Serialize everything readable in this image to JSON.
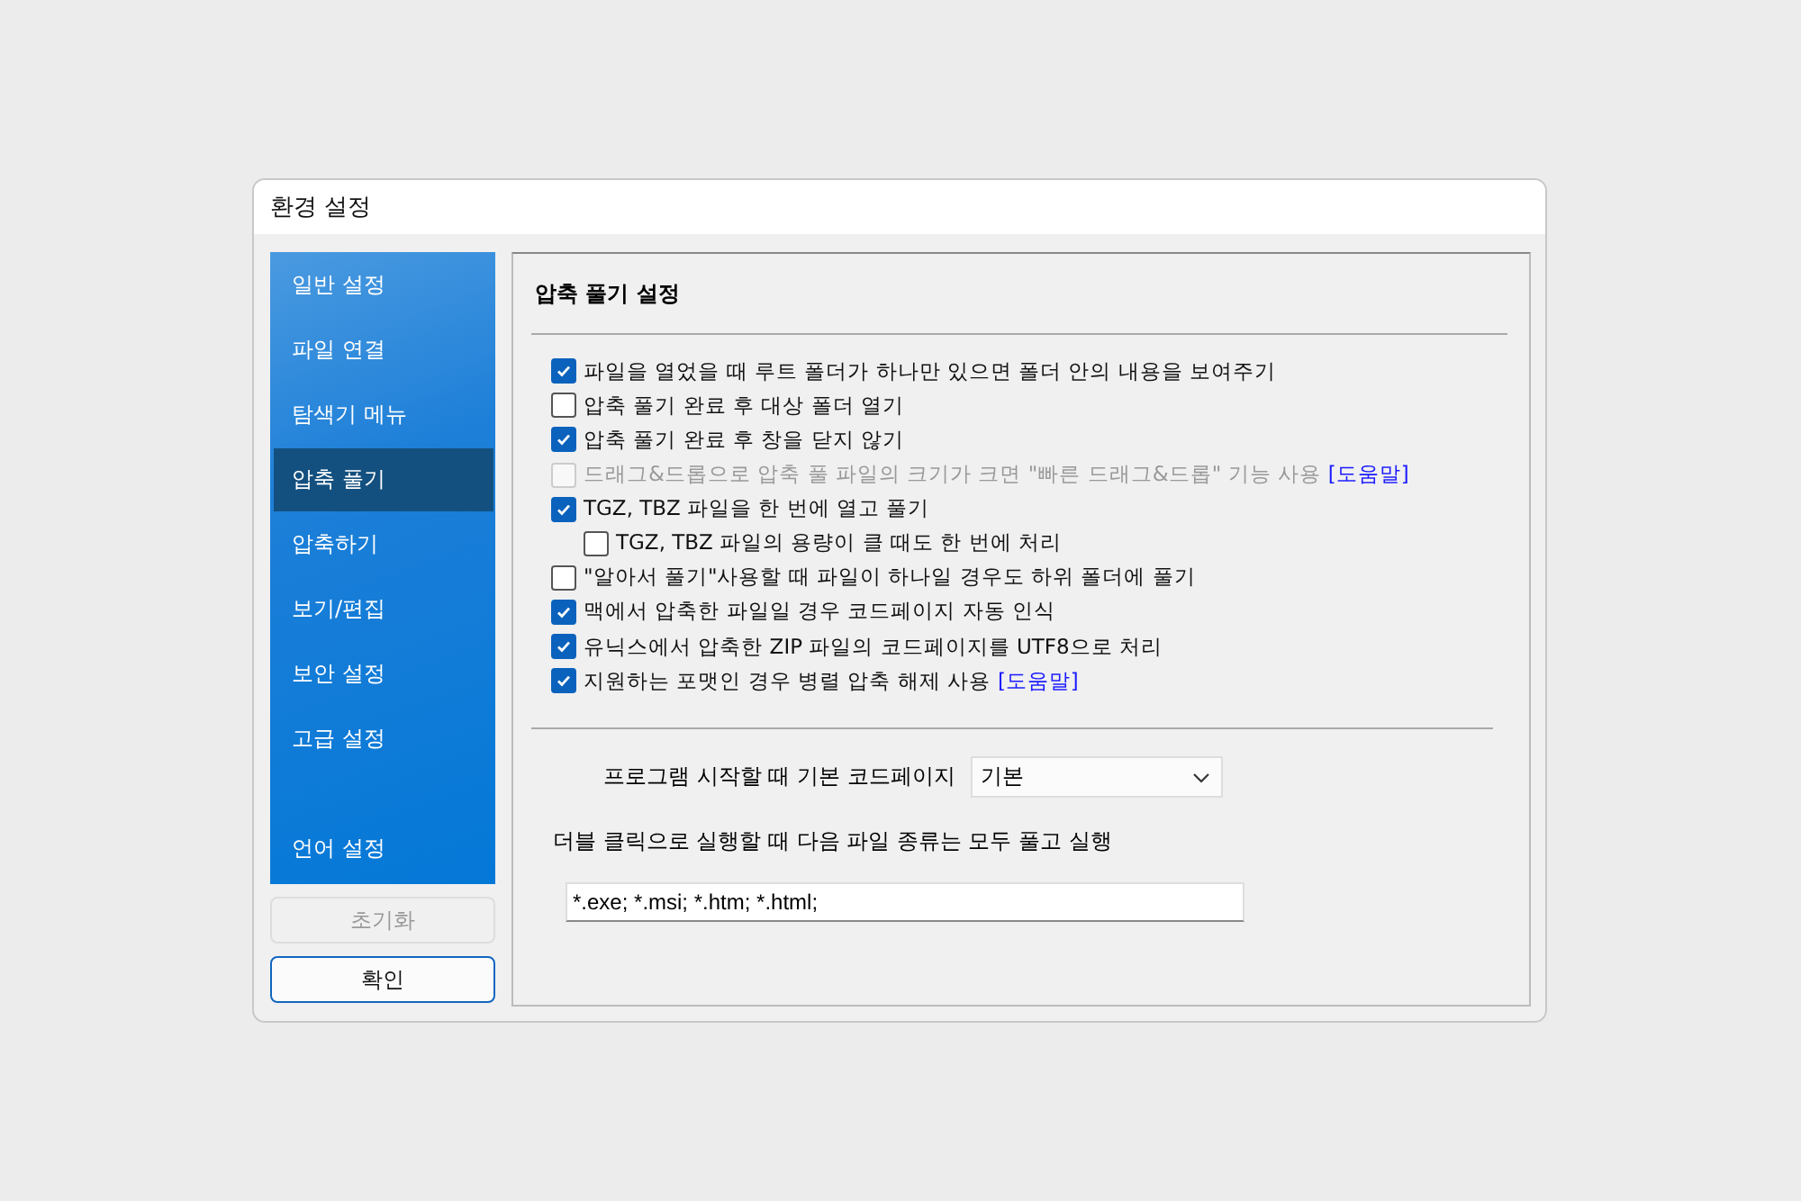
{
  "window": {
    "title": "환경 설정"
  },
  "sidebar": {
    "items": [
      {
        "label": "일반 설정",
        "selected": false
      },
      {
        "label": "파일 연결",
        "selected": false
      },
      {
        "label": "탐색기 메뉴",
        "selected": false
      },
      {
        "label": "압축 풀기",
        "selected": true
      },
      {
        "label": "압축하기",
        "selected": false
      },
      {
        "label": "보기/편집",
        "selected": false
      },
      {
        "label": "보안 설정",
        "selected": false
      },
      {
        "label": "고급 설정",
        "selected": false
      },
      {
        "label": "언어 설정",
        "selected": false
      }
    ]
  },
  "buttons": [
    {
      "label": "초기화",
      "disabled": true
    },
    {
      "label": "확인",
      "disabled": false
    }
  ],
  "panel": {
    "title": "압축 풀기 설정",
    "options": [
      {
        "label": "파일을 열었을 때 루트 폴더가 하나만 있으면 폴더 안의 내용을 보여주기",
        "checked": true,
        "disabled": false
      },
      {
        "label": "압축 풀기 완료 후 대상 폴더 열기",
        "checked": false,
        "disabled": false
      },
      {
        "label": "압축 풀기 완료 후 창을 닫지 않기",
        "checked": true,
        "disabled": false
      },
      {
        "label": "드래그&드롭으로 압축 풀 파일의 크기가 크면 \"빠른 드래그&드롭\" 기능 사용",
        "checked": false,
        "disabled": true,
        "help": "[도움말]"
      },
      {
        "label": "TGZ, TBZ 파일을 한 번에 열고 풀기",
        "checked": true,
        "disabled": false,
        "children": [
          {
            "label": "TGZ, TBZ 파일의 용량이 클 때도 한 번에 처리",
            "checked": false,
            "disabled": false
          }
        ]
      },
      {
        "label": "\"알아서 풀기\"사용할 때 파일이 하나일 경우도 하위 폴더에 풀기",
        "checked": false,
        "disabled": false
      },
      {
        "label": "맥에서 압축한 파일일 경우 코드페이지 자동 인식",
        "checked": true,
        "disabled": false
      },
      {
        "label": "유닉스에서 압축한 ZIP 파일의 코드페이지를 UTF8으로 처리",
        "checked": true,
        "disabled": false
      },
      {
        "label": "지원하는 포맷인 경우 병렬 압축 해제 사용",
        "checked": true,
        "disabled": false,
        "help": "[도움말]"
      }
    ],
    "codepage": {
      "label": "프로그램 시작할 때 기본 코드페이지",
      "value": "기본"
    },
    "auto_exec": {
      "label": "더블 클릭으로 실행할 때 다음 파일 종류는 모두 풀고 실행",
      "value": "*.exe; *.msi; *.htm; *.html;"
    }
  }
}
